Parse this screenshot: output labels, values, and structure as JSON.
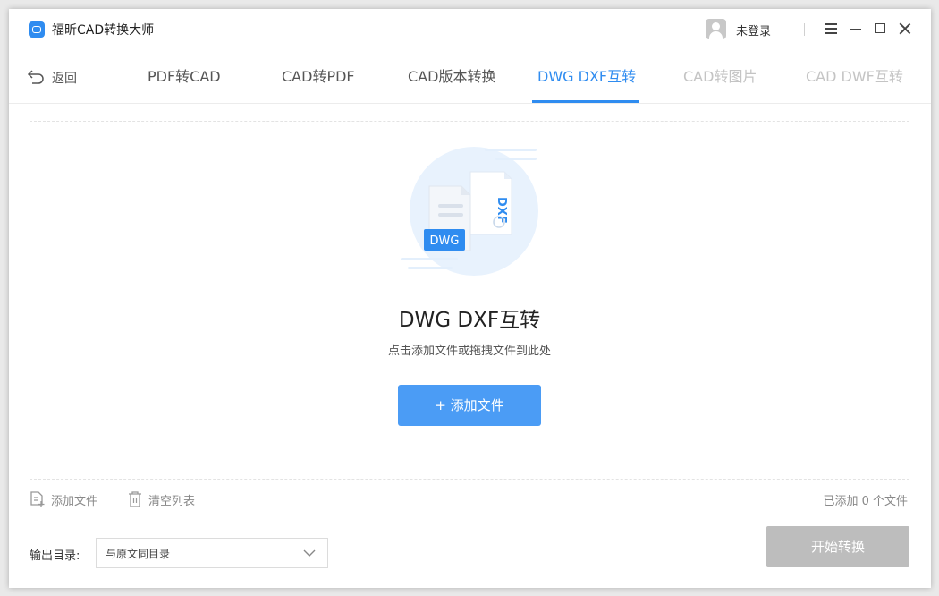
{
  "app": {
    "title": "福昕CAD转换大师"
  },
  "user": {
    "login_text": "未登录"
  },
  "nav": {
    "back_label": "返回",
    "tabs": [
      {
        "label": "PDF转CAD",
        "state": "normal"
      },
      {
        "label": "CAD转PDF",
        "state": "normal"
      },
      {
        "label": "CAD版本转换",
        "state": "normal"
      },
      {
        "label": "DWG DXF互转",
        "state": "active"
      },
      {
        "label": "CAD转图片",
        "state": "disabled"
      },
      {
        "label": "CAD DWF互转",
        "state": "disabled"
      }
    ]
  },
  "dropzone": {
    "illustration": {
      "front_label": "DWG",
      "back_label": "DXF"
    },
    "title": "DWG DXF互转",
    "hint": "点击添加文件或拖拽文件到此处",
    "add_button": "+ 添加文件"
  },
  "toolbar": {
    "add_file": "添加文件",
    "clear_list": "清空列表",
    "count_text": "已添加 0 个文件"
  },
  "output": {
    "label": "输出目录:",
    "selected": "与原文同目录"
  },
  "start_button": "开始转换",
  "colors": {
    "accent": "#2f8cf0",
    "button": "#4b9cf5",
    "disabled_button": "#bdbdbd",
    "disabled_tab": "#c4c4c4"
  }
}
